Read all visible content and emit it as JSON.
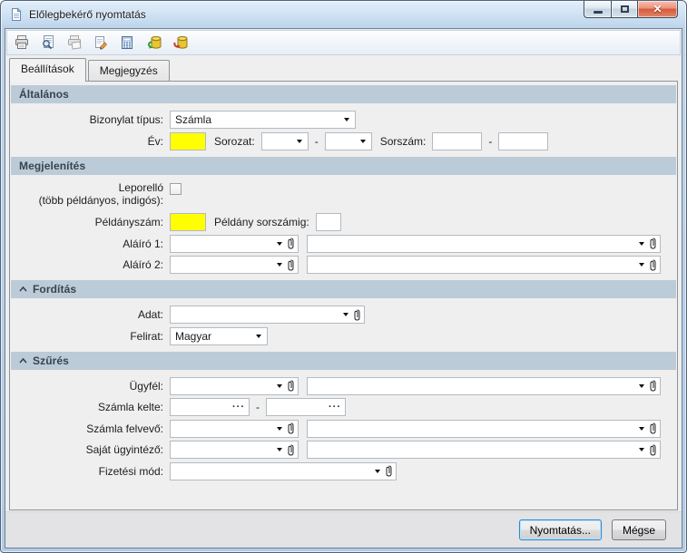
{
  "window": {
    "title": "Előlegbekérő nyomtatás"
  },
  "toolbar": {
    "icons": [
      "print-icon",
      "print-preview-icon",
      "print-setup-icon",
      "edit-icon",
      "calculator-icon",
      "database-import-icon",
      "database-export-icon"
    ]
  },
  "tabs": {
    "settings": "Beállítások",
    "notes": "Megjegyzés"
  },
  "sections": {
    "general": {
      "title": "Általános",
      "document_type_label": "Bizonylat típus:",
      "document_type_value": "Számla",
      "year_label": "Év:",
      "series_label": "Sorozat:",
      "serial_label": "Sorszám:",
      "range_separator": "-"
    },
    "display": {
      "title": "Megjelenítés",
      "leporello_label": "Leporelló",
      "leporello_sublabel": "(több példányos, indigós):",
      "copies_label": "Példányszám:",
      "copy_serial_label": "Példány sorszámig:",
      "signer1_label": "Aláíró 1:",
      "signer2_label": "Aláíró 2:"
    },
    "translation": {
      "title": "Fordítás",
      "data_label": "Adat:",
      "caption_label": "Felirat:",
      "caption_value": "Magyar"
    },
    "filter": {
      "title": "Szűrés",
      "customer_label": "Ügyfél:",
      "invoice_date_label": "Számla kelte:",
      "invoice_clerk_label": "Számla felvevő:",
      "own_clerk_label": "Saját ügyintéző:",
      "payment_method_label": "Fizetési mód:",
      "date_picker_label": "···",
      "range_separator": "-"
    }
  },
  "footer": {
    "print_button": "Nyomtatás...",
    "cancel_button": "Mégse"
  },
  "colors": {
    "section_header_bg": "#bccbd8",
    "highlight_field_bg": "#ffff00",
    "titlebar_top": "#e2eefa",
    "close_button_red": "#d4593c"
  }
}
